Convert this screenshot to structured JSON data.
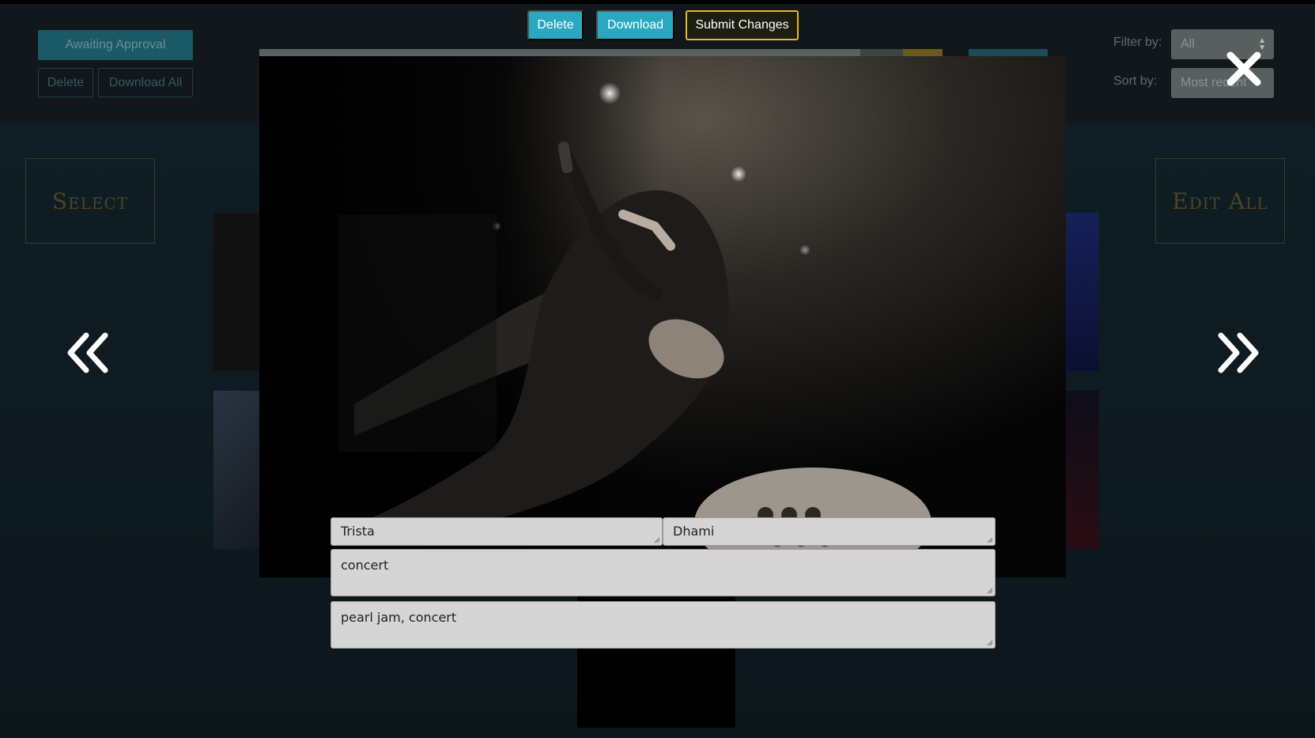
{
  "toolbar": {
    "awaiting_label": "Awaiting Approval",
    "delete_label": "Delete",
    "download_all_label": "Download All",
    "filter_label": "Filter by:",
    "filter_value": "All",
    "sort_label": "Sort by:",
    "sort_value": "Most recent"
  },
  "panels": {
    "select_label": "Select",
    "edit_all_label": "Edit All"
  },
  "modal": {
    "delete_label": "Delete",
    "download_label": "Download",
    "submit_label": "Submit Changes",
    "progress_fraction": 0.88,
    "first_name": "Trista",
    "last_name": "Dhami",
    "description": "concert",
    "tags": "pearl jam, concert"
  },
  "colors": {
    "accent_teal": "#2aa8bf",
    "accent_gold": "#e8b832"
  },
  "icons": {
    "close": "close-icon",
    "prev": "chevron-double-left-icon",
    "next": "chevron-double-right-icon"
  }
}
